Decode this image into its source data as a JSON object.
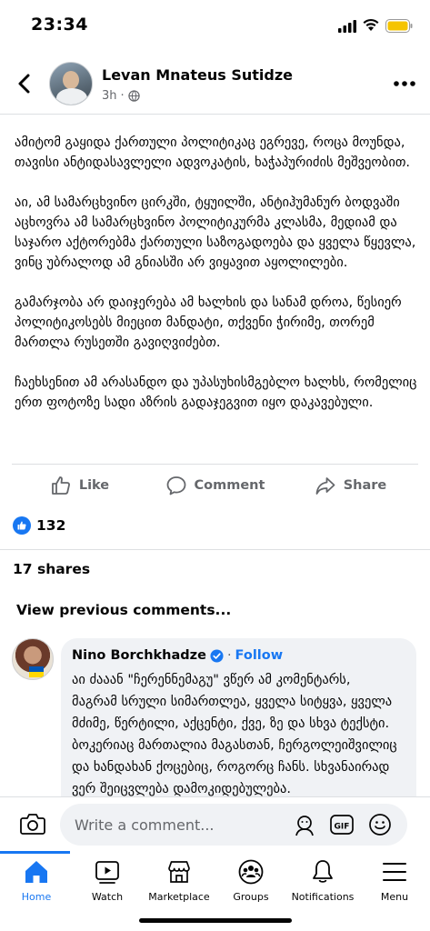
{
  "status_bar": {
    "time": "23:34"
  },
  "post": {
    "author": "Levan Mnateus Sutidze",
    "timestamp": "3h",
    "meta_separator": "·",
    "paragraphs": [
      "ამიტომ გაყიდა ქართული პოლიტიკაც ეგრევე, როცა მოუნდა, თავისი ანტიდასავლელი ადვოკატის, ხაჭაპურიძის მეშვეობით.",
      "აი, ამ სამარცხვინო ცირკში, ტყუილში, ანტიჰუმანურ ბოდვაში აცხოვრა ამ სამარცხვინო პოლიტიკურმა კლასმა, მედიამ და საჯარო აქტორებმა ქართული საზოგადოება და ყველა წყევლა, ვინც უბრალოდ ამ გნიასში არ ვიყავით აყოლილები.",
      "გამარჯობა არ დაიჯერება ამ ხალხის და სანამ დროა, წესიერ პოლიტიკოსებს მიეცით მანდატი, თქვენი ჭირიმე, თორემ მართლა რუსეთში გავიღვიძებთ.",
      "ჩაეხსენით ამ არასანდო და უპასუხისმგებლო ხალხს, რომელიც ერთ ფოტოზე სადი აზრის გადაჯეგვით იყო დაკავებული."
    ],
    "actions": {
      "like": "Like",
      "comment": "Comment",
      "share": "Share"
    },
    "reaction_count": "132",
    "shares": "17 shares"
  },
  "comments": {
    "view_previous": "View previous comments...",
    "items": [
      {
        "author": "Nino Borchkhadze",
        "separator": "·",
        "follow": "Follow",
        "text": "აი ძააან \"ჩერენნემაგუ\" ვწერ ამ კომენტარს, მაგრამ სრული სიმართლეა, ყველა სიტყვა, ყველა მძიმე, წერტილი, აქცენტი, ქვე, ზე და სხვა ტექსტი. ბოკერიაც მართალია მაგასთან, ჩერგოლეიშვილიც და ხანდახან ქოცებიც, როგორც ჩანს. სხვანაირად ვერ შეიცვლება დამოკიდებულება."
      }
    ]
  },
  "composer": {
    "placeholder": "Write a comment..."
  },
  "nav": {
    "tabs": [
      {
        "label": "Home",
        "icon": "home-icon",
        "active": true
      },
      {
        "label": "Watch",
        "icon": "watch-icon"
      },
      {
        "label": "Marketplace",
        "icon": "marketplace-icon"
      },
      {
        "label": "Groups",
        "icon": "groups-icon"
      },
      {
        "label": "Notifications",
        "icon": "bell-icon"
      },
      {
        "label": "Menu",
        "icon": "menu-icon"
      }
    ]
  },
  "colors": {
    "accent": "#1877f2",
    "text": "#050505",
    "muted": "#65676b",
    "bubble": "#f0f2f5",
    "battery": "#f5c400"
  }
}
